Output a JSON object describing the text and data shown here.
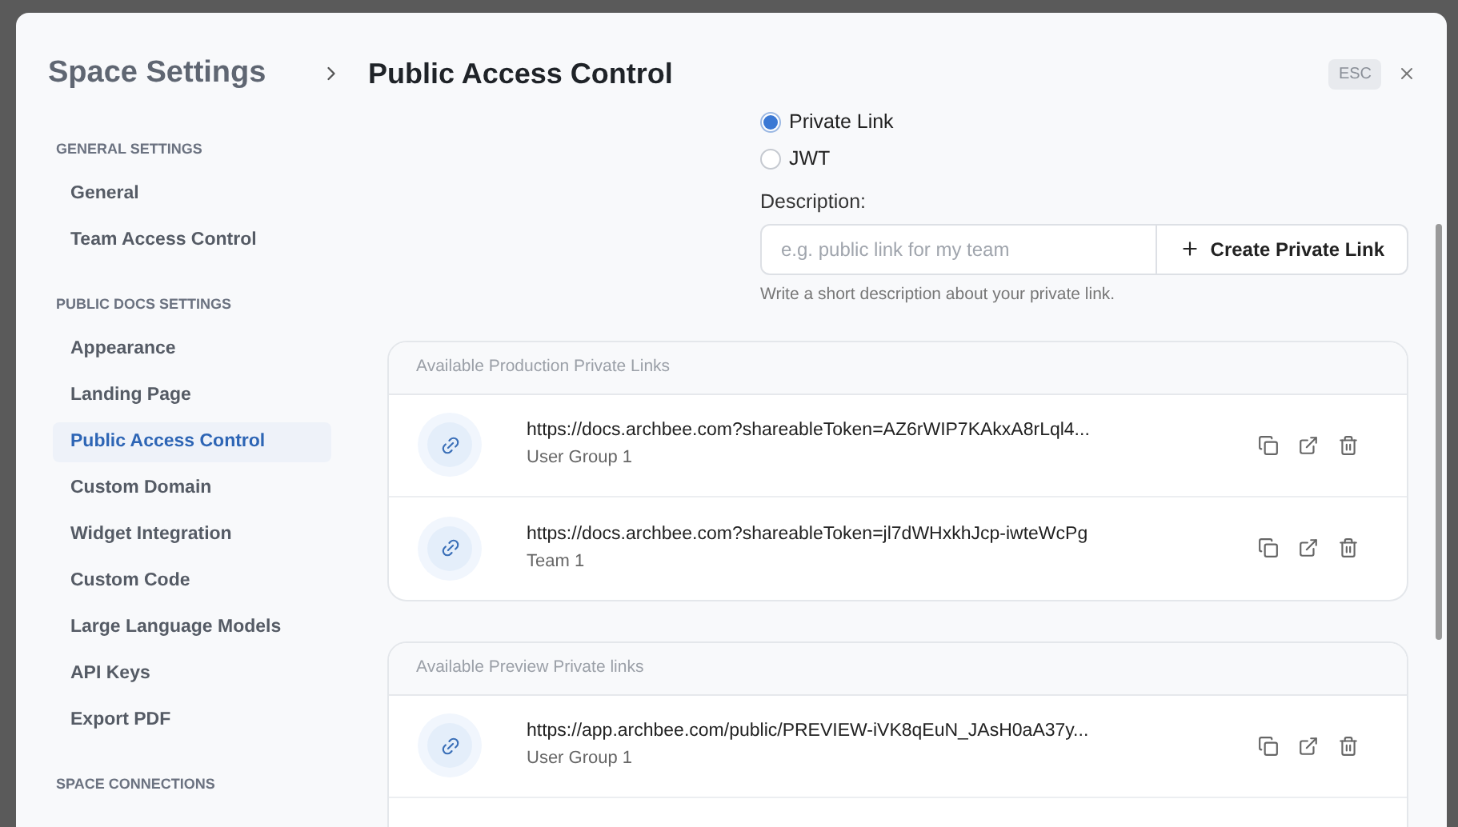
{
  "header": {
    "root": "Space Settings",
    "title": "Public Access Control",
    "esc_badge": "ESC"
  },
  "sidebar": {
    "sections": [
      {
        "heading": "GENERAL SETTINGS",
        "items": [
          {
            "label": "General",
            "selected": false
          },
          {
            "label": "Team Access Control",
            "selected": false
          }
        ]
      },
      {
        "heading": "PUBLIC DOCS SETTINGS",
        "items": [
          {
            "label": "Appearance",
            "selected": false
          },
          {
            "label": "Landing Page",
            "selected": false
          },
          {
            "label": "Public Access Control",
            "selected": true
          },
          {
            "label": "Custom Domain",
            "selected": false
          },
          {
            "label": "Widget Integration",
            "selected": false
          },
          {
            "label": "Custom Code",
            "selected": false
          },
          {
            "label": "Large Language Models",
            "selected": false
          },
          {
            "label": "API Keys",
            "selected": false
          },
          {
            "label": "Export PDF",
            "selected": false
          }
        ]
      },
      {
        "heading": "SPACE CONNECTIONS"
      }
    ]
  },
  "access_type": {
    "options": [
      {
        "label": "Private Link",
        "selected": true
      },
      {
        "label": "JWT",
        "selected": false
      }
    ]
  },
  "description": {
    "label": "Description:",
    "placeholder": "e.g. public link for my team",
    "button": "Create Private Link",
    "hint": "Write a short description about your private link."
  },
  "link_groups": [
    {
      "title": "Available Production Private Links",
      "links": [
        {
          "url": "https://docs.archbee.com?shareableToken=AZ6rWIP7KAkxA8rLql4...",
          "audience": "User Group 1"
        },
        {
          "url": "https://docs.archbee.com?shareableToken=jl7dWHxkhJcp-iwteWcPg",
          "audience": "Team 1"
        }
      ]
    },
    {
      "title": "Available Preview Private links",
      "links": [
        {
          "url": "https://app.archbee.com/public/PREVIEW-iVK8qEuN_JAsH0aA37y...",
          "audience": "User Group 1"
        }
      ]
    }
  ]
}
